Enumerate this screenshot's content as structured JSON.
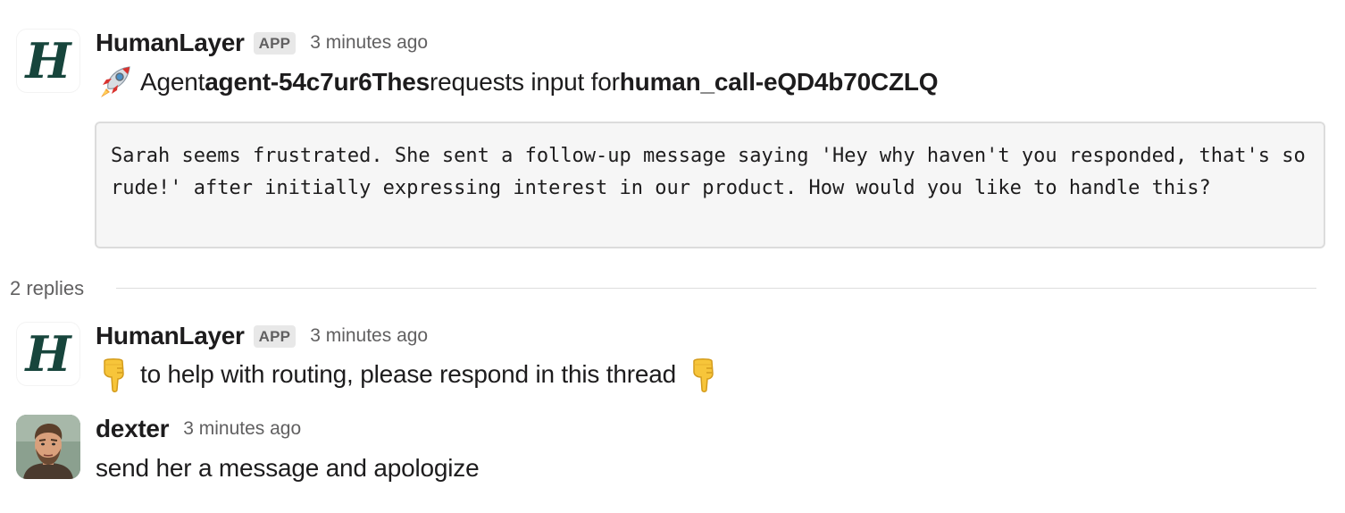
{
  "messages": [
    {
      "sender": "HumanLayer",
      "badge": "APP",
      "time": "3 minutes ago",
      "avatar_icon": "humanlayer-logo-icon",
      "avatar_letter": "H",
      "lead_emoji": "rocket-icon",
      "text_parts": {
        "p1": "Agent ",
        "agent_id": "agent-54c7ur6Thes",
        "p2": " requests input for ",
        "call_id": "human_call-eQD4b70CZLQ"
      },
      "code_block": "Sarah seems frustrated. She sent a follow-up message saying 'Hey why haven't you responded, that's so rude!' after initially expressing interest in our product. How would you like to handle this?"
    },
    {
      "sender": "HumanLayer",
      "badge": "APP",
      "time": "3 minutes ago",
      "avatar_icon": "humanlayer-logo-icon",
      "avatar_letter": "H",
      "lead_emoji": "pointing-down-icon",
      "text": "to help with routing, please respond in this thread",
      "trail_emoji": "pointing-down-icon"
    },
    {
      "sender": "dexter",
      "time": "3 minutes ago",
      "avatar_icon": "user-avatar-photo",
      "text": "send her a message and apologize"
    }
  ],
  "thread": {
    "replies_label": "2 replies"
  },
  "colors": {
    "logo": "#17453c",
    "text": "#1d1c1d",
    "muted": "#616061",
    "badge_bg": "#e8e8e8",
    "code_bg": "#f6f6f6",
    "code_border": "#dcdcdc"
  }
}
